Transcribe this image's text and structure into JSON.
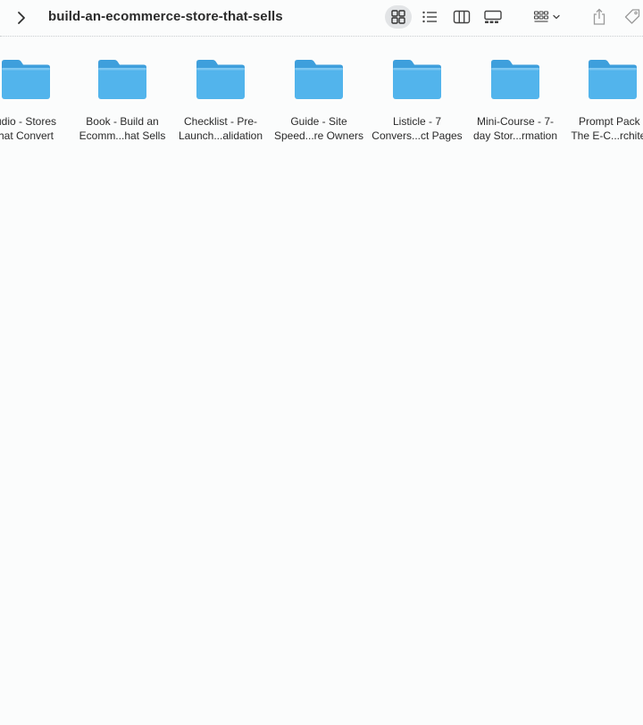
{
  "window": {
    "title": "build-an-ecommerce-store-that-sells"
  },
  "toolbar": {
    "back_icon": "chevron-right-icon",
    "view_modes": [
      "icon-view-icon",
      "list-view-icon",
      "column-view-icon",
      "gallery-view-icon"
    ],
    "active_view": "icon-view",
    "group_icon": "group-by-icon",
    "share_icon": "share-icon",
    "tag_icon": "tag-icon"
  },
  "colors": {
    "folder_body": "#52b4ec",
    "folder_tab": "#3e9fdc",
    "folder_shade": "#7cc7f2",
    "background": "#fbfcfc",
    "active_button": "#e2e4e6"
  },
  "items": [
    {
      "line1": "udio - Stores",
      "line2": "hat Convert"
    },
    {
      "line1": "Book - Build an",
      "line2": "Ecomm...hat Sells"
    },
    {
      "line1": "Checklist - Pre-",
      "line2": "Launch...alidation"
    },
    {
      "line1": "Guide - Site",
      "line2": "Speed...re Owners"
    },
    {
      "line1": "Listicle - 7",
      "line2": "Convers...ct Pages"
    },
    {
      "line1": "Mini-Course - 7-",
      "line2": "day Stor...rmation"
    },
    {
      "line1": "Prompt Pack -",
      "line2": "The E-C...rchitect"
    }
  ]
}
